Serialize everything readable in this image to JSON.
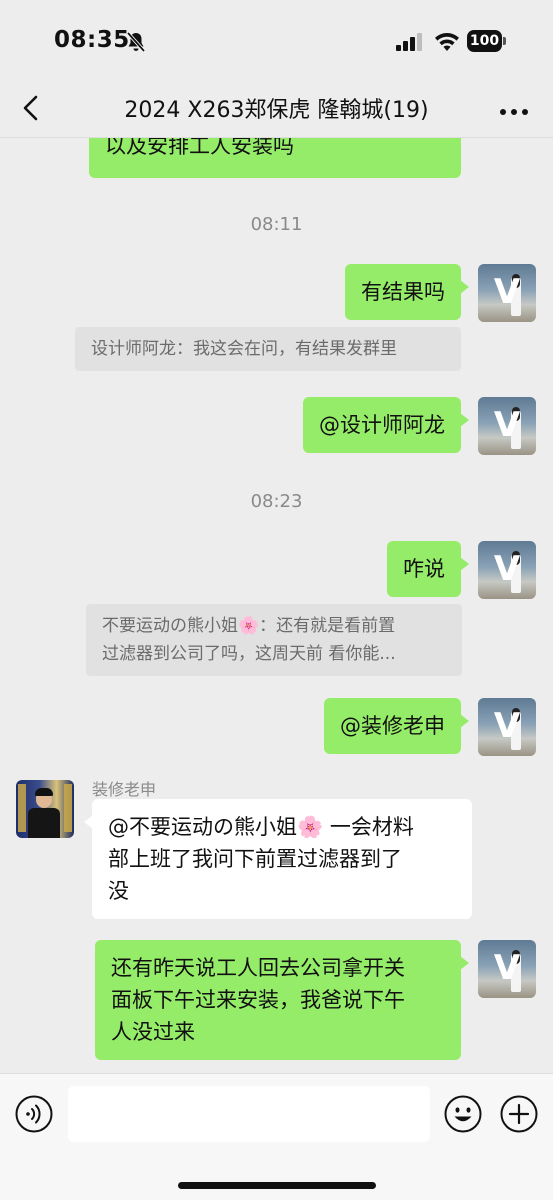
{
  "status_bar": {
    "time": "08:35",
    "battery": "100"
  },
  "nav": {
    "title": "2024 X263郑保虎 隆翰城(19)"
  },
  "avatars": {
    "self_letter": "V"
  },
  "messages": {
    "m1_text": "以及安排工人安装吗",
    "t1": "08:11",
    "m2_text": "有结果吗",
    "q1_text": "设计师阿龙：我这会在问，有结果发群里",
    "m3_text": "@设计师阿龙",
    "t2": "08:23",
    "m4_text": "咋说",
    "q2_line1": "不要运动の熊小姐🌸：还有就是看前置",
    "q2_line2": "过滤器到公司了吗，这周天前 看你能...",
    "m5_text": "@装修老申",
    "m6_sender": "装修老申",
    "m6_line1": "@不要运动の熊小姐🌸 一会材料",
    "m6_line2": "部上班了我问下前置过滤器到了",
    "m6_line3": "没",
    "m7_line1": "还有昨天说工人回去公司拿开关",
    "m7_line2": "面板下午过来安装，我爸说下午",
    "m7_line3": "人没过来"
  },
  "input": {
    "value": ""
  },
  "colors": {
    "background": "#ededed",
    "sent_bubble": "#95ec69",
    "received_bubble": "#ffffff",
    "quote": "#e1e1e1"
  },
  "icons": [
    "bell-slash-icon",
    "signal-icon",
    "wifi-icon",
    "back-icon",
    "more-icon",
    "voice-icon",
    "emoji-icon",
    "plus-icon"
  ]
}
